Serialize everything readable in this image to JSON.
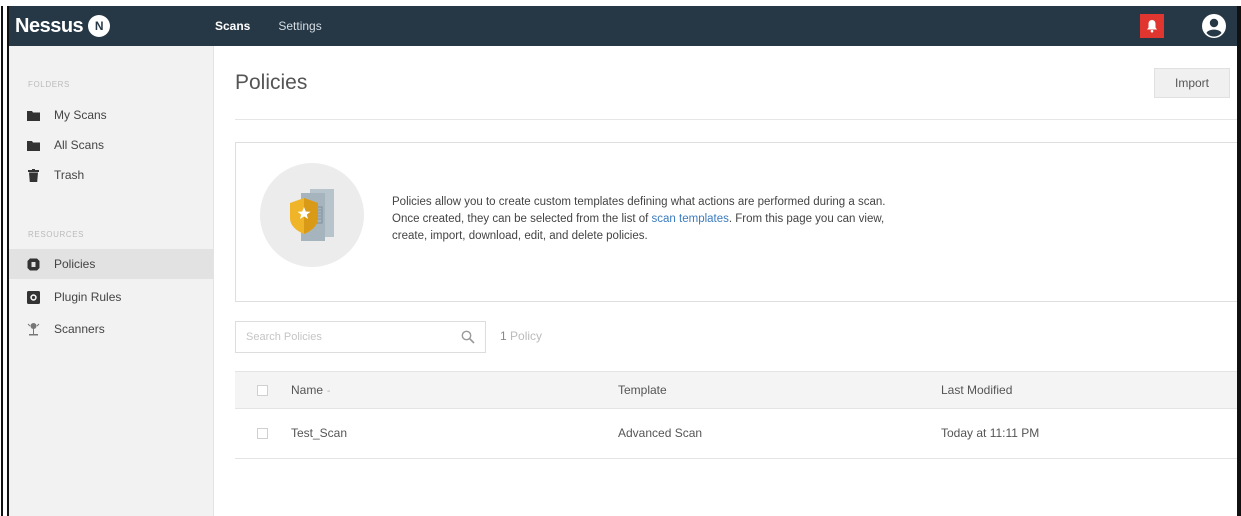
{
  "app": {
    "logo_text": "Nessus",
    "logo_badge": "N"
  },
  "nav": {
    "items": [
      {
        "label": "Scans"
      },
      {
        "label": "Settings"
      }
    ]
  },
  "sidebar": {
    "folders_label": "FOLDERS",
    "resources_label": "RESOURCES",
    "folders": [
      {
        "label": "My Scans",
        "icon": "folder-icon"
      },
      {
        "label": "All Scans",
        "icon": "folder-icon"
      },
      {
        "label": "Trash",
        "icon": "trash-icon"
      }
    ],
    "resources": [
      {
        "label": "Policies",
        "icon": "shield-icon",
        "active": true
      },
      {
        "label": "Plugin Rules",
        "icon": "plugin-icon"
      },
      {
        "label": "Scanners",
        "icon": "scanner-icon"
      }
    ]
  },
  "main": {
    "title": "Policies",
    "import_label": "Import",
    "info": {
      "line1": "Policies allow you to create custom templates defining what actions are performed during a scan.",
      "line2_before": "Once created, they can be selected from the list of ",
      "line2_link": "scan templates",
      "line2_after": ". From this page you can view,",
      "line3": "create, import, download, edit, and delete policies."
    },
    "search": {
      "placeholder": "Search Policies"
    },
    "count": {
      "number": "1",
      "label": "Policy"
    },
    "table": {
      "headers": {
        "name": "Name",
        "sort_indicator": "-",
        "template": "Template",
        "modified": "Last Modified"
      },
      "rows": [
        {
          "name": "Test_Scan",
          "template": "Advanced Scan",
          "modified": "Today at 11:11 PM"
        }
      ]
    }
  },
  "colors": {
    "topbar": "#263846",
    "alert": "#e0362f",
    "link": "#3b7bbf",
    "policy_icon": "#f0b429"
  }
}
